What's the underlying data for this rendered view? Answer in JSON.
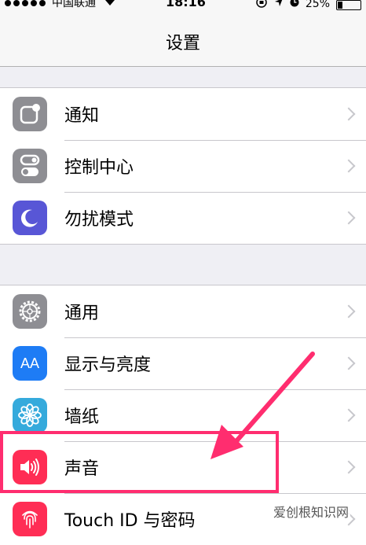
{
  "status_bar": {
    "carrier": "中国联通",
    "time": "18:16",
    "battery": "25%"
  },
  "nav": {
    "title": "设置"
  },
  "group1": [
    {
      "label": "通知",
      "icon": "notification-icon"
    },
    {
      "label": "控制中心",
      "icon": "control-center-icon"
    },
    {
      "label": "勿扰模式",
      "icon": "moon-icon"
    }
  ],
  "group2": [
    {
      "label": "通用",
      "icon": "gear-icon"
    },
    {
      "label": "显示与亮度",
      "icon": "display-brightness-icon",
      "icon_text": "AA"
    },
    {
      "label": "墙纸",
      "icon": "wallpaper-flower-icon"
    },
    {
      "label": "声音",
      "icon": "speaker-icon"
    },
    {
      "label": "Touch ID 与密码",
      "icon": "fingerprint-icon"
    }
  ],
  "watermark": "爱创根知识网",
  "colors": {
    "highlight": "#ff2d6f",
    "arrow": "#ff2d6f",
    "background": "#efeff4"
  }
}
